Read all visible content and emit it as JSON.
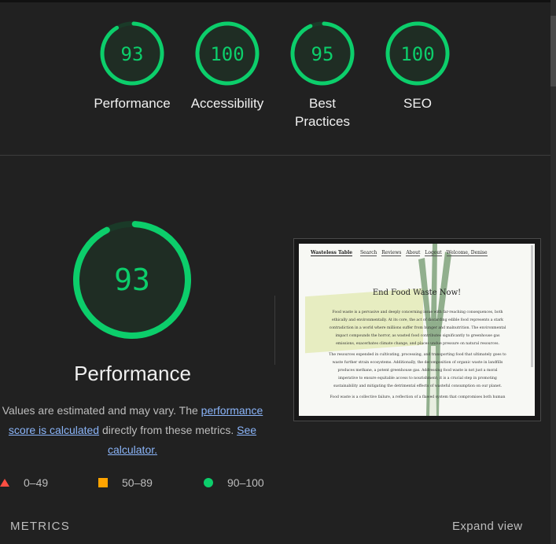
{
  "scores": [
    {
      "value": "93",
      "label": "Performance",
      "fraction": 0.93
    },
    {
      "value": "100",
      "label": "Accessibility",
      "fraction": 1.0
    },
    {
      "value": "95",
      "label": "Best Practices",
      "fraction": 0.95
    },
    {
      "value": "100",
      "label": "SEO",
      "fraction": 1.0
    }
  ],
  "main": {
    "score": "93",
    "fraction": 0.93,
    "title": "Performance",
    "desc_prefix": "Values are estimated and may vary. The ",
    "desc_link1": "performance score is calculated",
    "desc_mid": " directly from these metrics. ",
    "desc_link2": "See calculator."
  },
  "legend": [
    {
      "range": "0–49",
      "shape": "triangle",
      "color": "#ff4e42"
    },
    {
      "range": "50–89",
      "shape": "square",
      "color": "#ffa400"
    },
    {
      "range": "90–100",
      "shape": "circle",
      "color": "#0cce6b"
    }
  ],
  "colors": {
    "pass": "#0cce6b",
    "track": "#1a3a28",
    "fill": "#1f2d24"
  },
  "screenshot": {
    "brand": "Wasteless Table",
    "nav": [
      "Search",
      "Reviews",
      "About",
      "Logout",
      "Welcome, Denise"
    ],
    "heading": "End Food Waste Now!",
    "para1": "Food waste is a pervasive and deeply concerning issue with far-reaching consequences, both ethically and environmentally. At its core, the act of discarding edible food represents a stark contradiction in a world where millions suffer from hunger and malnutrition. The environmental impact compounds the horror, as wasted food contributes significantly to greenhouse gas emissions, exacerbates climate change, and places undue pressure on natural resources.",
    "para2": "The resources expended in cultivating, processing, and transporting food that ultimately goes to waste further strain ecosystems. Additionally, the decomposition of organic waste in landfills produces methane, a potent greenhouse gas. Addressing food waste is not just a moral imperative to ensure equitable access to nourishment; it is a crucial step in promoting sustainability and mitigating the detrimental effects of wasteful consumption on our planet.",
    "para3": "Food waste is a collective failure, a reflection of a flawed system that compromises both human"
  },
  "footer": {
    "metrics": "METRICS",
    "expand": "Expand view"
  }
}
